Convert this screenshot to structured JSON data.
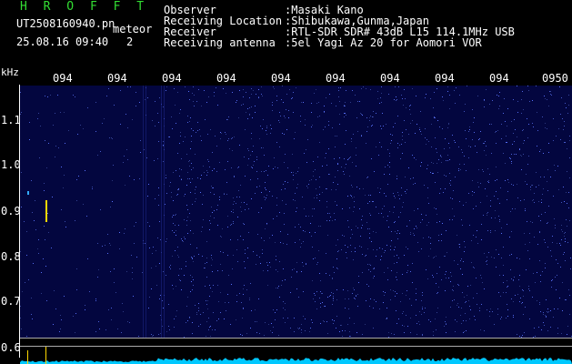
{
  "header": {
    "brand": "H R O F F T",
    "filename": "UT2508160940.pn",
    "meteor_label": "meteor",
    "datetime": "25.08.16 09:40",
    "count": "2",
    "fields": [
      {
        "label": "Observer",
        "value": ":Masaki Kano"
      },
      {
        "label": "Receiving Location",
        "value": ":Shibukawa,Gunma,Japan"
      },
      {
        "label": "Receiver",
        "value": ":RTL-SDR SDR# 43dB L15 114.1MHz USB"
      },
      {
        "label": "Receiving antenna",
        "value": ":5el Yagi Az 20 for Aomori VOR"
      }
    ]
  },
  "axes": {
    "y_unit": "kHz",
    "y_ticks": [
      "1.1",
      "1.0",
      "0.9",
      "0.8",
      "0.7",
      "0.6"
    ],
    "x_ticks": [
      "094",
      "094",
      "094",
      "094",
      "094",
      "094",
      "094",
      "094",
      "094",
      "0950"
    ]
  },
  "colors": {
    "background": "#000000",
    "spectrogram": "#03063f",
    "brand": "#33dd33",
    "noise_strip": "#00c8ff"
  }
}
